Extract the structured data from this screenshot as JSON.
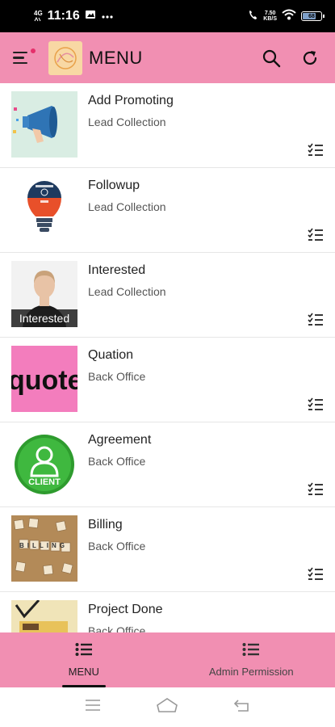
{
  "status_bar": {
    "network": "4G",
    "time": "11:16",
    "speed_value": "7.50",
    "speed_unit": "KB/S",
    "battery_level": "68"
  },
  "app_bar": {
    "title": "MENU",
    "icons": [
      "menu-icon",
      "search-icon",
      "refresh-icon"
    ]
  },
  "items": [
    {
      "title": "Add Promoting",
      "subtitle": "Lead Collection",
      "image": "megaphone"
    },
    {
      "title": "Followup",
      "subtitle": "Lead Collection",
      "image": "followup-bulb"
    },
    {
      "title": "Interested",
      "subtitle": "Lead Collection",
      "image": "person",
      "image_caption": "Interested"
    },
    {
      "title": "Quation",
      "subtitle": "Back Office",
      "image": "quote-text",
      "image_text": "quote"
    },
    {
      "title": "Agreement",
      "subtitle": "Back Office",
      "image": "client-badge",
      "image_text": "CLIENT"
    },
    {
      "title": "Billing",
      "subtitle": "Back Office",
      "image": "billing-tiles",
      "image_text": "BILLING"
    },
    {
      "title": "Project Done",
      "subtitle": "Back Office",
      "image": "project-done"
    }
  ],
  "bottom_nav": {
    "tabs": [
      {
        "label": "MENU",
        "active": true
      },
      {
        "label": "Admin Permission",
        "active": false
      }
    ]
  },
  "colors": {
    "accent": "#f18fb2",
    "status_bar": "#000000",
    "divider": "#e6e6e6"
  }
}
